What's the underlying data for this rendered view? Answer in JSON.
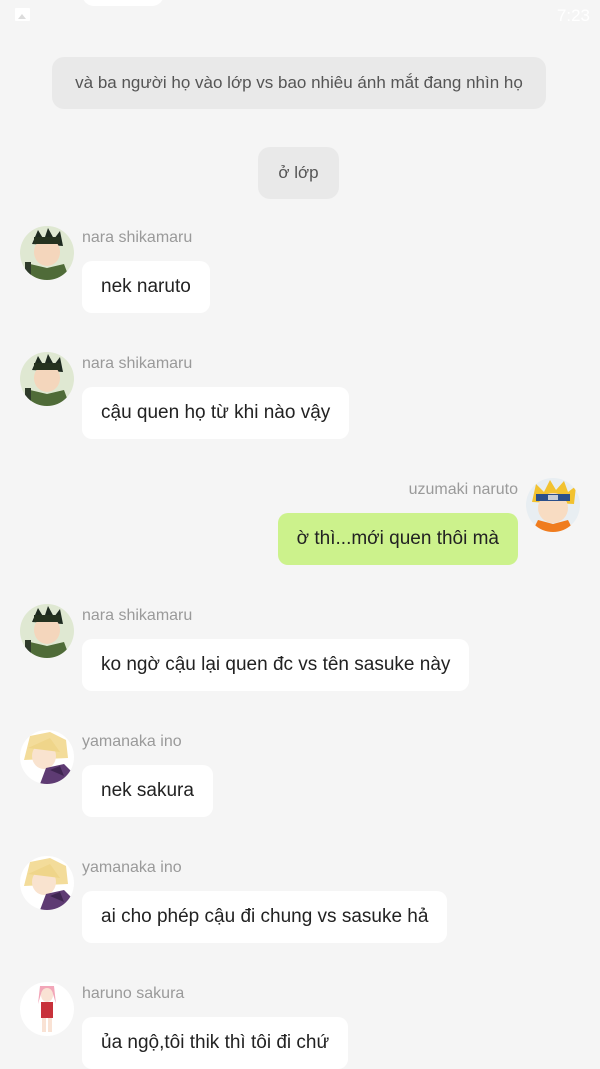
{
  "status_bar": {
    "time": "7:23",
    "icon": "image-icon"
  },
  "narrations": [
    "và ba người họ vào lớp vs bao nhiêu ánh mắt đang nhìn họ",
    "ở lớp"
  ],
  "messages": [
    {
      "side": "left",
      "name": "nara shikamaru",
      "text": "nek naruto",
      "avatar": "shikamaru-avatar"
    },
    {
      "side": "left",
      "name": "nara shikamaru",
      "text": "cậu quen họ từ khi nào vậy",
      "avatar": "shikamaru-avatar"
    },
    {
      "side": "right",
      "name": "uzumaki naruto",
      "text": "ờ thì...mới quen thôi mà",
      "avatar": "naruto-avatar"
    },
    {
      "side": "left",
      "name": "nara shikamaru",
      "text": "ko ngờ cậu lại quen đc vs tên sasuke này",
      "avatar": "shikamaru-avatar"
    },
    {
      "side": "left",
      "name": "yamanaka ino",
      "text": "nek sakura",
      "avatar": "ino-avatar"
    },
    {
      "side": "left",
      "name": "yamanaka ino",
      "text": "ai cho phép cậu đi chung vs sasuke hả",
      "avatar": "ino-avatar"
    },
    {
      "side": "left",
      "name": "haruno sakura",
      "text": "ủa ngộ,tôi thik thì tôi đi chứ",
      "avatar": "sakura-avatar"
    }
  ],
  "colors": {
    "background": "#f5f5f5",
    "narration_bg": "#e9e9e9",
    "left_bubble": "#ffffff",
    "right_bubble": "#ccf28c",
    "name_text": "#9a9a9a"
  }
}
